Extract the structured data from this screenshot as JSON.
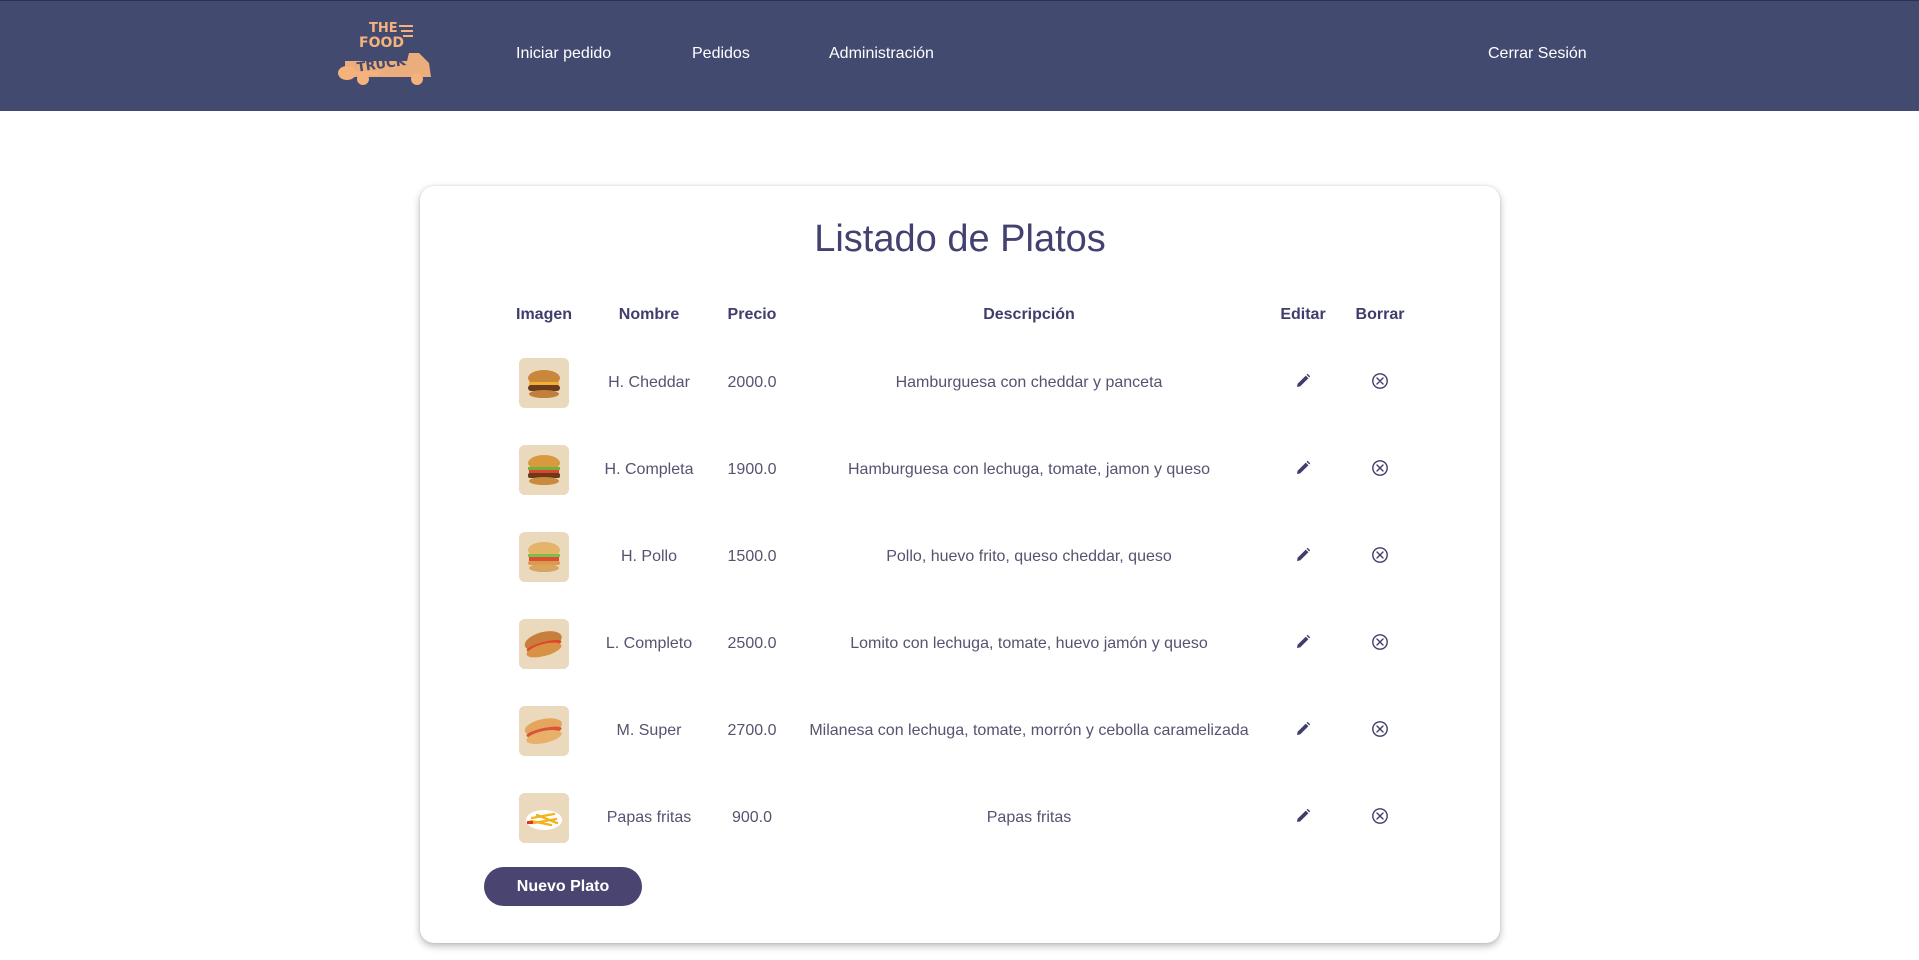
{
  "nav": {
    "logo_text": [
      "THE",
      "FOOD",
      "TRUCK"
    ],
    "links": [
      "Iniciar pedido",
      "Pedidos",
      "Administración"
    ],
    "logout": "Cerrar Sesión"
  },
  "page": {
    "title": "Listado de Platos"
  },
  "table": {
    "headers": {
      "image": "Imagen",
      "name": "Nombre",
      "price": "Precio",
      "description": "Descripción",
      "edit": "Editar",
      "delete": "Borrar"
    },
    "rows": [
      {
        "name": "H. Cheddar",
        "price": "2000.0",
        "description": "Hamburguesa con cheddar y panceta",
        "image": "burger-cheddar-photo"
      },
      {
        "name": "H. Completa",
        "price": "1900.0",
        "description": "Hamburguesa con lechuga, tomate, jamon y queso",
        "image": "burger-complete-photo"
      },
      {
        "name": "H. Pollo",
        "price": "1500.0",
        "description": "Pollo, huevo frito, queso cheddar, queso",
        "image": "chicken-burger-photo"
      },
      {
        "name": "L. Completo",
        "price": "2500.0",
        "description": "Lomito con lechuga, tomate, huevo jamón y queso",
        "image": "lomito-sandwich-photo"
      },
      {
        "name": "M. Super",
        "price": "2700.0",
        "description": "Milanesa con lechuga, tomate, morrón y cebolla caramelizada",
        "image": "milanesa-sandwich-photo"
      },
      {
        "name": "Papas fritas",
        "price": "900.0",
        "description": "Papas fritas",
        "image": "fries-photo"
      }
    ],
    "edit_icon": "pencil-icon",
    "delete_icon": "close-circle-icon"
  },
  "actions": {
    "new_dish": "Nuevo Plato"
  },
  "colors": {
    "navbar": "#424a70",
    "logo": "#f5b27c",
    "title": "#424170",
    "button": "#4a4570"
  }
}
